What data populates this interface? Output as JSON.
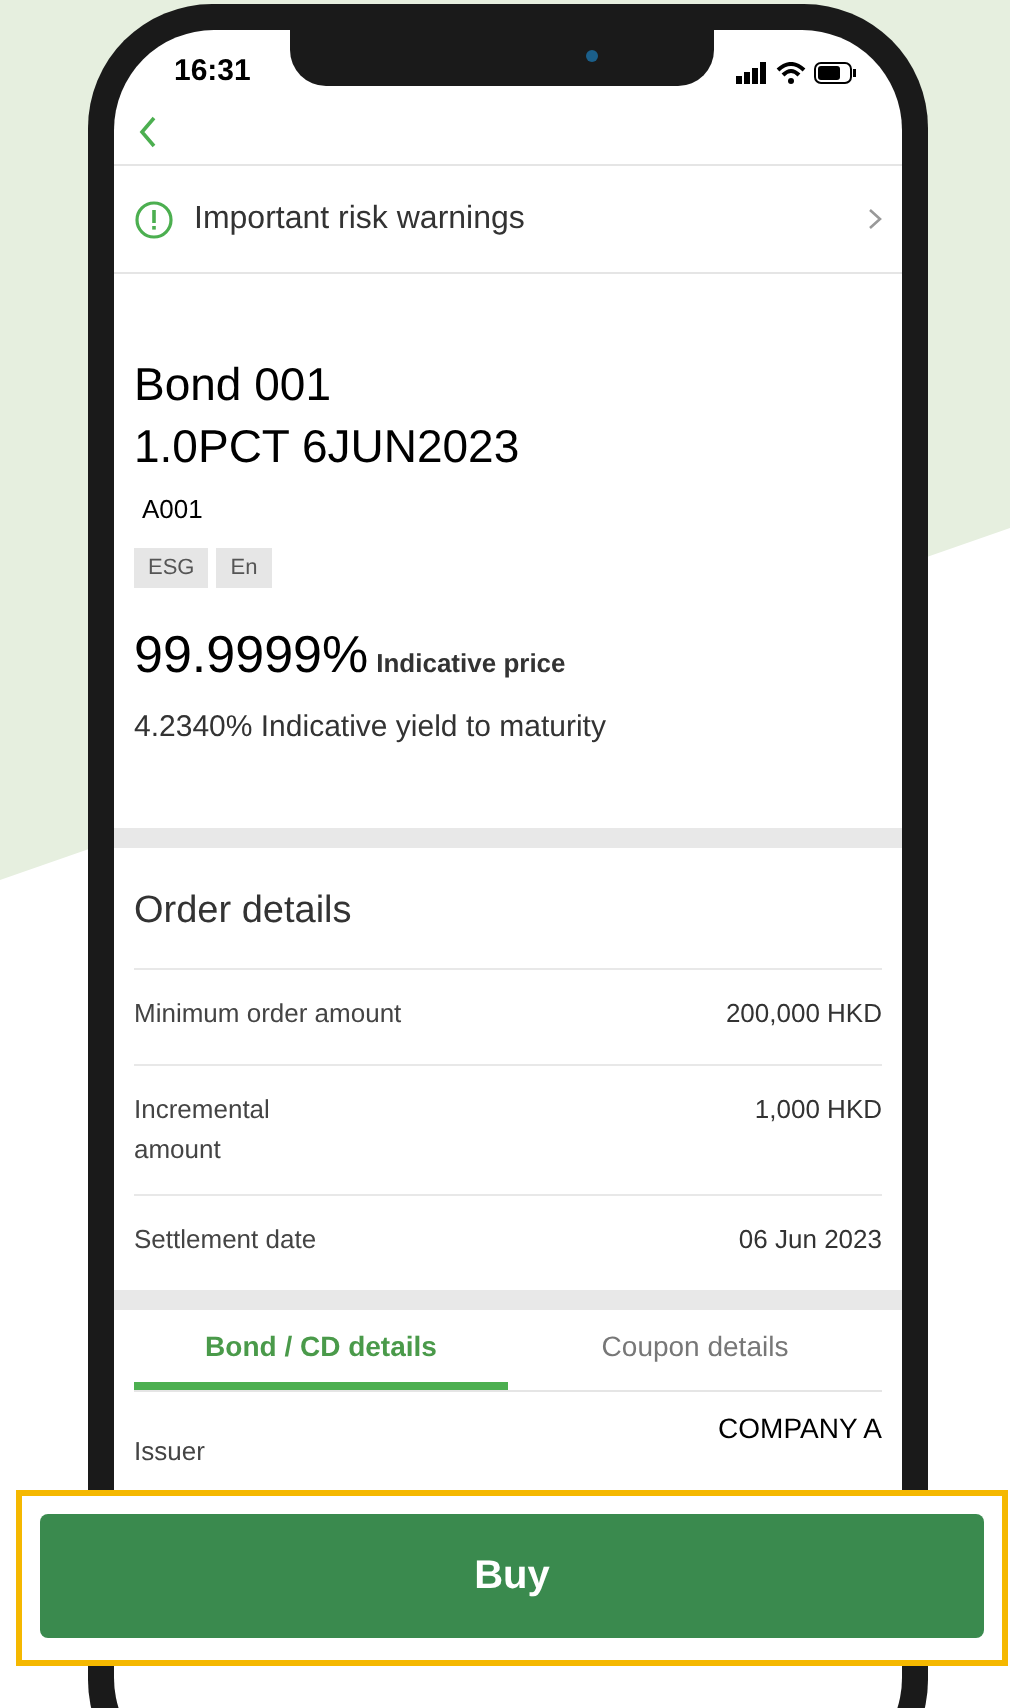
{
  "status_bar": {
    "time": "16:31"
  },
  "risk_warning": {
    "label": "Important risk warnings"
  },
  "bond": {
    "name": "Bond 001",
    "description": "1.0PCT 6JUN2023",
    "code": "A001",
    "tags": [
      "ESG",
      "En"
    ],
    "price": "99.9999%",
    "price_label": "Indicative price",
    "yield": "4.2340% Indicative yield to maturity"
  },
  "order_details": {
    "title": "Order details",
    "rows": [
      {
        "label": "Minimum order amount",
        "value": "200,000 HKD"
      },
      {
        "label": "Incremental amount",
        "value": "1,000 HKD"
      },
      {
        "label": "Settlement date",
        "value": "06 Jun 2023"
      }
    ]
  },
  "tabs": [
    {
      "label": "Bond / CD details",
      "selected": true
    },
    {
      "label": "Coupon details",
      "selected": false
    }
  ],
  "details": [
    {
      "label": "Issuer",
      "value": "COMPANY A"
    }
  ],
  "buy_button": {
    "label": "Buy"
  }
}
